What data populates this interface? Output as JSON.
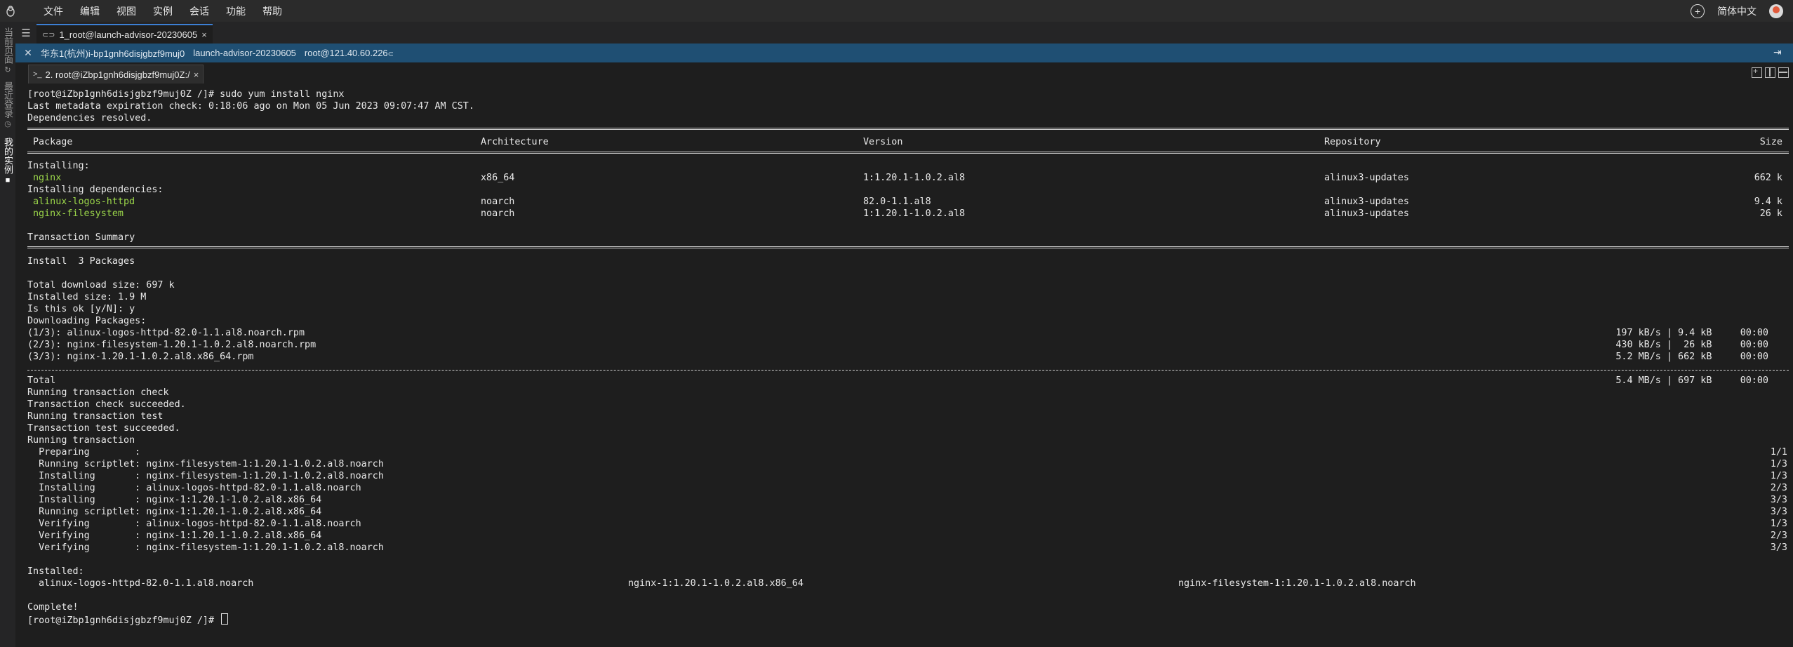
{
  "menubar": {
    "items": [
      "文件",
      "编辑",
      "视图",
      "实例",
      "会话",
      "功能",
      "帮助"
    ],
    "language": "简体中文"
  },
  "sidebar": {
    "tabs": [
      "当前页面",
      "最近登录",
      "我的实例"
    ]
  },
  "session_tabs": [
    {
      "label": "1_root@launch-advisor-20230605",
      "close": "×"
    }
  ],
  "infobar": {
    "region": "华东1(杭州)i-bp1gnh6disjgbzf9muj0",
    "instance_name": "launch-advisor-20230605",
    "user_ip": "root@121.40.60.226"
  },
  "terminal_tabs": [
    {
      "label": "2. root@iZbp1gnh6disjgbzf9muj0Z:/",
      "close": "×"
    }
  ],
  "terminal": {
    "prompt_cmd": "[root@iZbp1gnh6disjgbzf9muj0Z /]# sudo yum install nginx",
    "meta": "Last metadata expiration check: 0:18:06 ago on Mon 05 Jun 2023 09:07:47 AM CST.",
    "deps_resolved": "Dependencies resolved.",
    "table_header": {
      "package": "Package",
      "arch": "Architecture",
      "version": "Version",
      "repo": "Repository",
      "size": "Size"
    },
    "installing_label": "Installing:",
    "installing_deps_label": "Installing dependencies:",
    "packages": [
      {
        "name": "nginx",
        "arch": "x86_64",
        "version": "1:1.20.1-1.0.2.al8",
        "repo": "alinux3-updates",
        "size": "662 k"
      },
      {
        "name": "alinux-logos-httpd",
        "arch": "noarch",
        "version": "82.0-1.1.al8",
        "repo": "alinux3-updates",
        "size": "9.4 k"
      },
      {
        "name": "nginx-filesystem",
        "arch": "noarch",
        "version": "1:1.20.1-1.0.2.al8",
        "repo": "alinux3-updates",
        "size": "26 k"
      }
    ],
    "transaction_summary": "Transaction Summary",
    "install_summary": "Install  3 Packages",
    "total_download": "Total download size: 697 k",
    "installed_size": "Installed size: 1.9 M",
    "is_ok": "Is this ok [y/N]: y",
    "downloading": "Downloading Packages:",
    "downloads": [
      {
        "file": "(1/3): alinux-logos-httpd-82.0-1.1.al8.noarch.rpm",
        "stats": "197 kB/s | 9.4 kB     00:00"
      },
      {
        "file": "(2/3): nginx-filesystem-1.20.1-1.0.2.al8.noarch.rpm",
        "stats": "430 kB/s |  26 kB     00:00"
      },
      {
        "file": "(3/3): nginx-1.20.1-1.0.2.al8.x86_64.rpm",
        "stats": "5.2 MB/s | 662 kB     00:00"
      }
    ],
    "total_label": "Total",
    "total_stats": "5.4 MB/s | 697 kB     00:00",
    "steps": [
      "Running transaction check",
      "Transaction check succeeded.",
      "Running transaction test",
      "Transaction test succeeded.",
      "Running transaction"
    ],
    "actions": [
      {
        "text": "  Preparing        :",
        "count": "1/1"
      },
      {
        "text": "  Running scriptlet: nginx-filesystem-1:1.20.1-1.0.2.al8.noarch",
        "count": "1/3"
      },
      {
        "text": "  Installing       : nginx-filesystem-1:1.20.1-1.0.2.al8.noarch",
        "count": "1/3"
      },
      {
        "text": "  Installing       : alinux-logos-httpd-82.0-1.1.al8.noarch",
        "count": "2/3"
      },
      {
        "text": "  Installing       : nginx-1:1.20.1-1.0.2.al8.x86_64",
        "count": "3/3"
      },
      {
        "text": "  Running scriptlet: nginx-1:1.20.1-1.0.2.al8.x86_64",
        "count": "3/3"
      },
      {
        "text": "  Verifying        : alinux-logos-httpd-82.0-1.1.al8.noarch",
        "count": "1/3"
      },
      {
        "text": "  Verifying        : nginx-1:1.20.1-1.0.2.al8.x86_64",
        "count": "2/3"
      },
      {
        "text": "  Verifying        : nginx-filesystem-1:1.20.1-1.0.2.al8.noarch",
        "count": "3/3"
      }
    ],
    "installed_label": "Installed:",
    "installed": [
      "alinux-logos-httpd-82.0-1.1.al8.noarch",
      "nginx-1:1.20.1-1.0.2.al8.x86_64",
      "nginx-filesystem-1:1.20.1-1.0.2.al8.noarch"
    ],
    "complete": "Complete!",
    "final_prompt": "[root@iZbp1gnh6disjgbzf9muj0Z /]# "
  }
}
